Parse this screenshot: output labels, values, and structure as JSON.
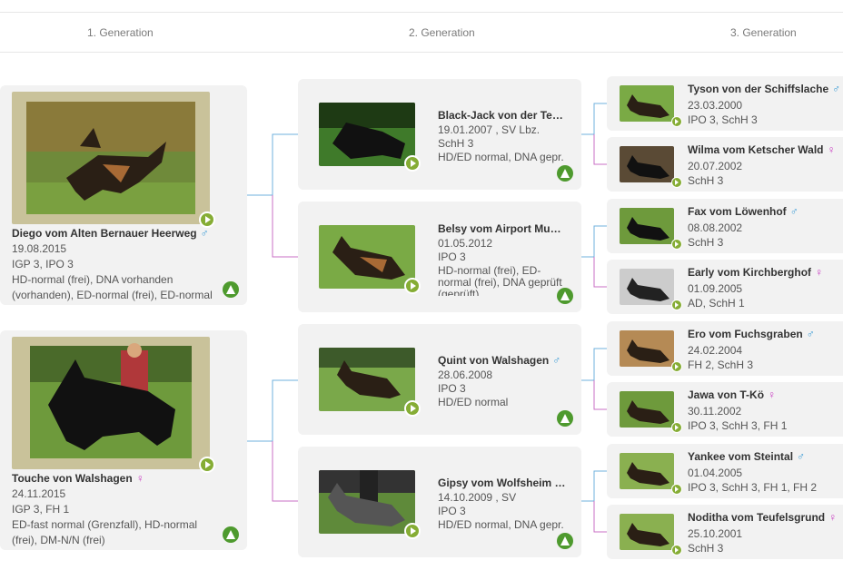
{
  "generations": [
    "1. Generation",
    "2. Generation",
    "3. Generation"
  ],
  "gen1": [
    {
      "name": "Diego vom Alten Bernauer Heerweg",
      "sex": "♂",
      "date": "19.08.2015",
      "titles": "IGP 3, IPO 3",
      "health1": "HD-normal (frei), DNA vorhanden",
      "health2": "(vorhanden), ED-normal (frei), ED-normal"
    },
    {
      "name": "Touche von Walshagen",
      "sex": "♀",
      "date": "24.11.2015",
      "titles": "IGP 3, FH 1",
      "health1": "ED-fast normal (Grenzfall), HD-normal",
      "health2": "(frei), DM-N/N (frei)"
    }
  ],
  "gen2": [
    {
      "name": "Black-Jack von der Te…",
      "date": "19.01.2007 , SV Lbz.",
      "titles": "SchH 3",
      "health1": "HD/ED normal, DNA gepr.",
      "health2": "",
      "health3": ""
    },
    {
      "name": "Belsy vom Airport Mu…",
      "date": "01.05.2012",
      "titles": "IPO 3",
      "health1": "HD-normal (frei), ED-",
      "health2": "normal (frei), DNA geprüft",
      "health3": "(geprüft)"
    },
    {
      "name": "Quint von Walshagen",
      "sex": "♂",
      "date": "28.06.2008",
      "titles": "IPO 3",
      "health1": "HD/ED normal",
      "health2": "",
      "health3": ""
    },
    {
      "name": "Gipsy vom Wolfsheim …",
      "date": "14.10.2009 , SV",
      "titles": "IPO 3",
      "health1": "HD/ED normal, DNA gepr.",
      "health2": "",
      "health3": ""
    }
  ],
  "gen3": [
    {
      "name": "Tyson von der Schiffslache",
      "sex": "♂",
      "date": "23.03.2000",
      "titles": "IPO 3, SchH 3"
    },
    {
      "name": "Wilma vom Ketscher Wald",
      "sex": "♀",
      "date": "20.07.2002",
      "titles": "SchH 3"
    },
    {
      "name": "Fax vom Löwenhof",
      "sex": "♂",
      "date": "08.08.2002",
      "titles": "SchH 3"
    },
    {
      "name": "Early vom Kirchberghof",
      "sex": "♀",
      "date": "01.09.2005",
      "titles": "AD, SchH 1"
    },
    {
      "name": "Ero vom Fuchsgraben",
      "sex": "♂",
      "date": "24.02.2004",
      "titles": "FH 2, SchH 3"
    },
    {
      "name": "Jawa von T-Kö",
      "sex": "♀",
      "date": "30.11.2002",
      "titles": "IPO 3, SchH 3, FH 1"
    },
    {
      "name": "Yankee vom Steintal",
      "sex": "♂",
      "date": "01.04.2005",
      "titles": "IPO 3, SchH 3, FH 1, FH 2"
    },
    {
      "name": "Noditha vom Teufelsgrund",
      "sex": "♀",
      "date": "25.10.2001",
      "titles": "SchH 3"
    }
  ],
  "colors": {
    "male": "#3a9bd5",
    "female": "#c93fc2",
    "accent": "#86ad35",
    "card": "#f2f2f2"
  },
  "icons": {
    "play": "play-icon",
    "pedigree": "pedigree-icon"
  }
}
